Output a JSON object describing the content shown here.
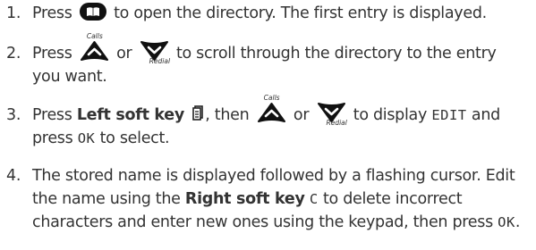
{
  "steps": [
    {
      "number": "1.",
      "press": "Press",
      "after_icon": "to open the directory. The first entry is displayed."
    },
    {
      "number": "2.",
      "press": "Press",
      "or": "or",
      "after_icons": "to scroll through the directory to the entry",
      "line2": "you want."
    },
    {
      "number": "3.",
      "press": "Press",
      "key": "Left soft key",
      "then": ", then",
      "or": "or",
      "to_display": "to display",
      "lcd_edit": "EDIT",
      "and": "and",
      "line2_press": "press",
      "lcd_ok": "OK",
      "to_select": "to select."
    },
    {
      "number": "4.",
      "line1": "The stored name is displayed followed by a flashing cursor. Edit",
      "line2_pre": "the name using the",
      "key": "Right soft key",
      "lcd_c": "C",
      "line2_post": "to delete incorrect",
      "line3": "characters and enter new ones using the keypad, then press",
      "lcd_ok": "OK",
      "end": "."
    }
  ],
  "icons": {
    "up_key": {
      "name": "calls-up-key-icon",
      "label": "Calls"
    },
    "down_key": {
      "name": "redial-down-key-icon",
      "label": "Redial"
    },
    "directory_key": {
      "name": "directory-book-icon"
    },
    "soft_key": {
      "name": "left-soft-key-icon"
    }
  },
  "colors": {
    "text": "#333333",
    "key_fill": "#111111",
    "key_arrow": "#ffffff"
  }
}
